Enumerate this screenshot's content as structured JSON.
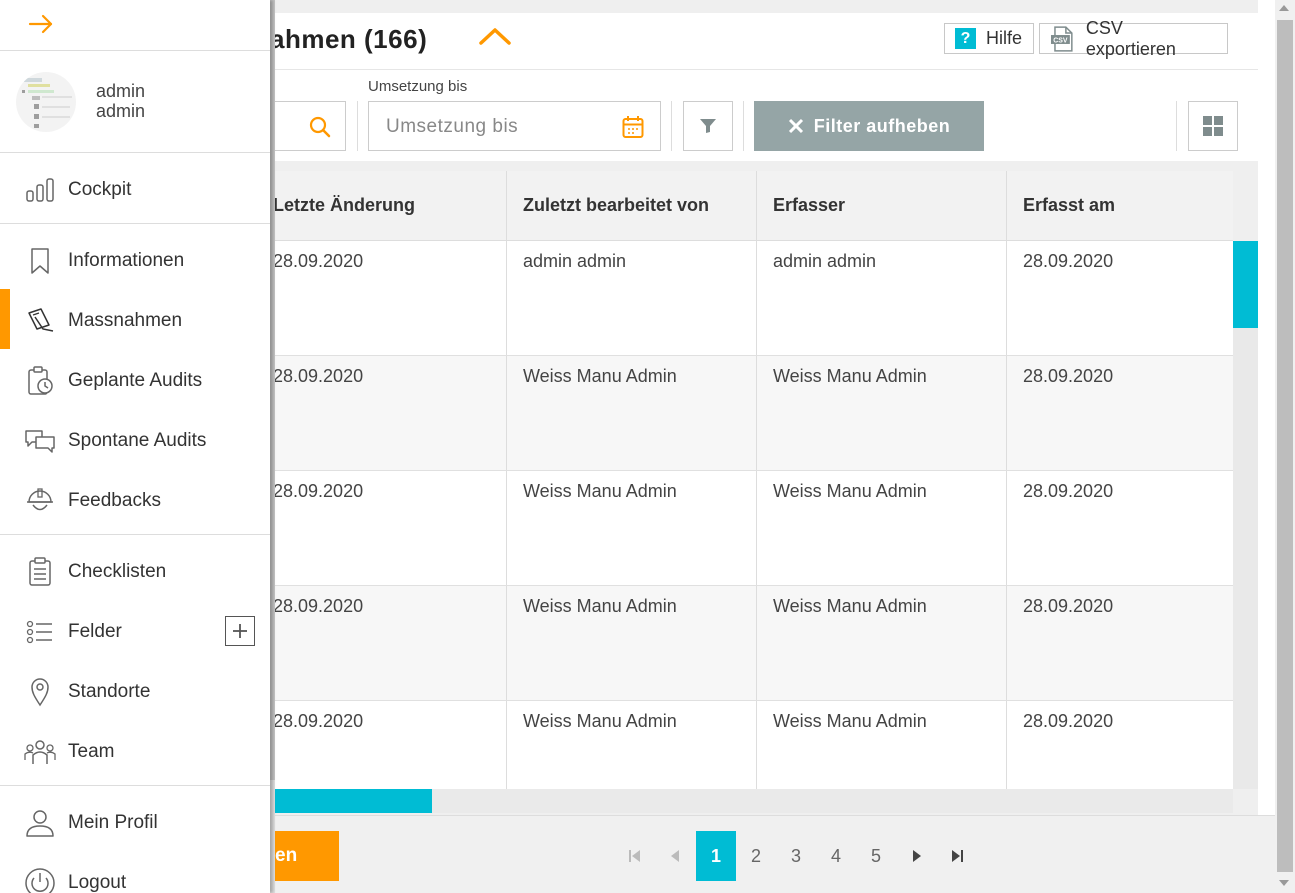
{
  "header": {
    "title": "ahmen (166)",
    "help_label": "Hilfe",
    "help_icon_text": "?",
    "csv_label": "CSV exportieren"
  },
  "filters": {
    "umsetzung_bis_label": "Umsetzung bis",
    "umsetzung_bis_placeholder": "Umsetzung bis",
    "clear_label": "Filter aufheben"
  },
  "table": {
    "columns": [
      "Letzte Änderung",
      "Zuletzt bearbeitet von",
      "Erfasser",
      "Erfasst am"
    ],
    "rows": [
      [
        "28.09.2020",
        "admin admin",
        "admin admin",
        "28.09.2020"
      ],
      [
        "28.09.2020",
        "Weiss Manu Admin",
        "Weiss Manu Admin",
        "28.09.2020"
      ],
      [
        "28.09.2020",
        "Weiss Manu Admin",
        "Weiss Manu Admin",
        "28.09.2020"
      ],
      [
        "28.09.2020",
        "Weiss Manu Admin",
        "Weiss Manu Admin",
        "28.09.2020"
      ],
      [
        "28.09.2020",
        "Weiss Manu Admin",
        "Weiss Manu Admin",
        "28.09.2020"
      ]
    ]
  },
  "footer": {
    "action_label": "en",
    "pages": [
      "1",
      "2",
      "3",
      "4",
      "5"
    ],
    "active_page": "1"
  },
  "sidebar": {
    "user_first": "admin",
    "user_last": "admin",
    "items": [
      {
        "label": "Cockpit",
        "icon": "bar-chart-icon"
      },
      {
        "label": "Informationen",
        "icon": "bookmark-icon"
      },
      {
        "label": "Massnahmen",
        "icon": "edit-note-icon"
      },
      {
        "label": "Geplante Audits",
        "icon": "clipboard-clock-icon"
      },
      {
        "label": "Spontane Audits",
        "icon": "chat-bubbles-icon"
      },
      {
        "label": "Feedbacks",
        "icon": "helmet-icon"
      },
      {
        "label": "Checklisten",
        "icon": "checklist-icon"
      },
      {
        "label": "Felder",
        "icon": "list-icon"
      },
      {
        "label": "Standorte",
        "icon": "location-pin-icon"
      },
      {
        "label": "Team",
        "icon": "team-icon"
      },
      {
        "label": "Mein Profil",
        "icon": "user-icon"
      },
      {
        "label": "Logout",
        "icon": "power-icon"
      }
    ]
  },
  "colors": {
    "accent": "#ff9800",
    "teal": "#00bcd4",
    "filter_button": "#95a5a6"
  }
}
